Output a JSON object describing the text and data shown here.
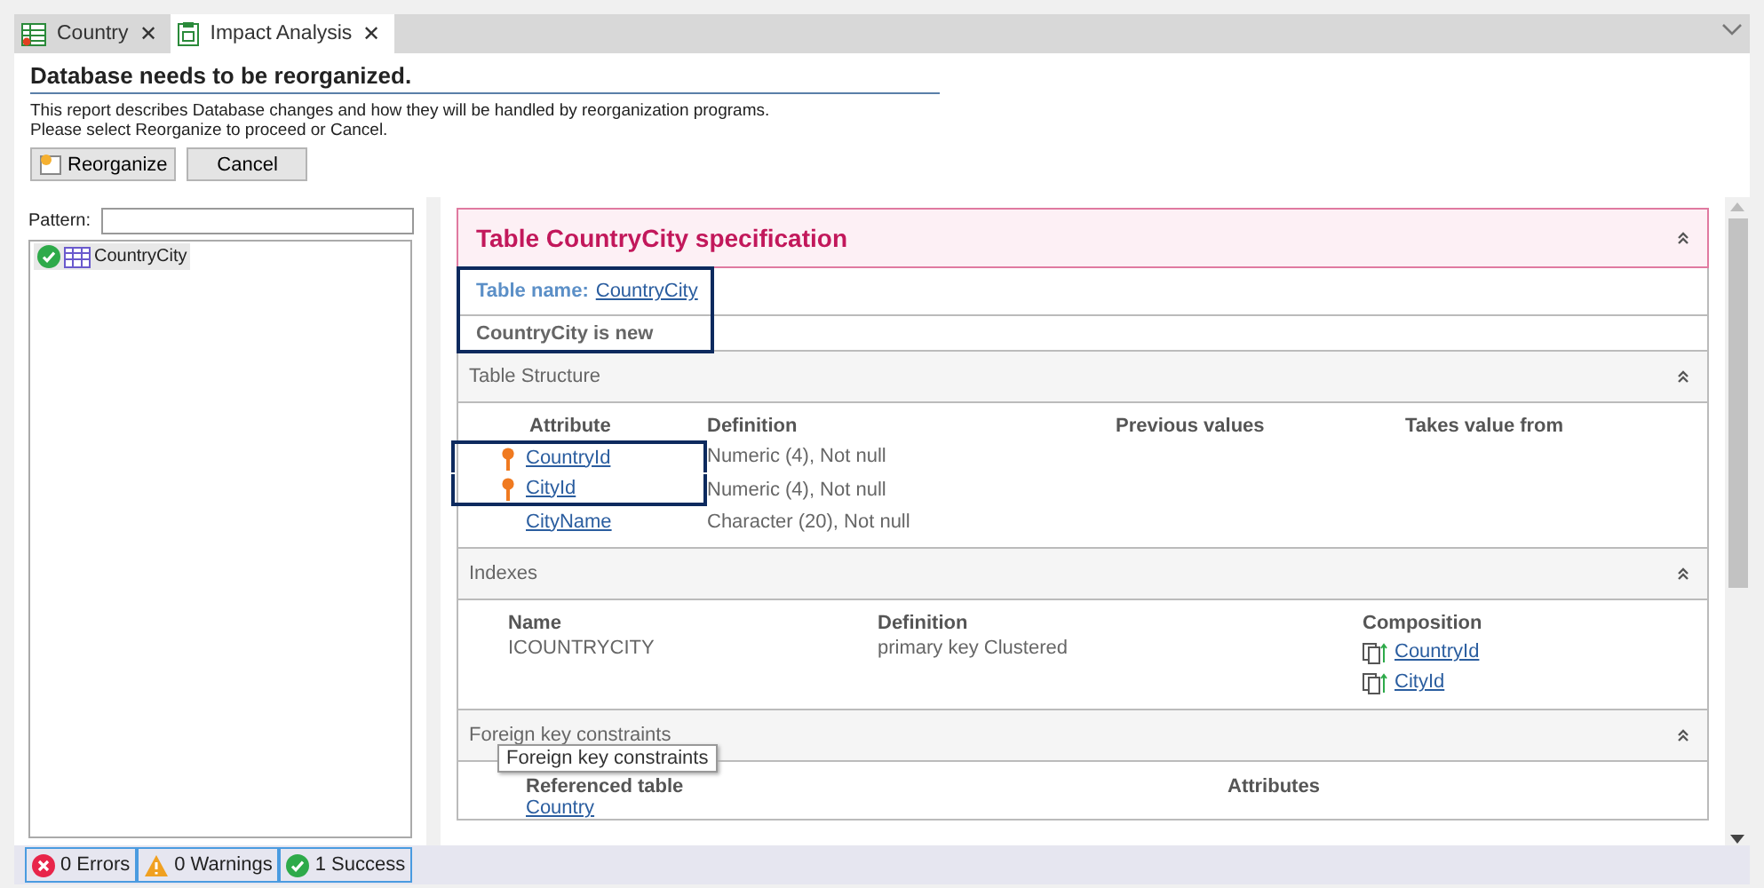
{
  "tabs": [
    {
      "label": "Country",
      "kind": "transaction",
      "selected": false,
      "close": "✕"
    },
    {
      "label": "Impact Analysis",
      "kind": "report",
      "selected": true,
      "close": "✕"
    }
  ],
  "header": {
    "title": "Database needs to be reorganized.",
    "description": [
      "This report describes Database changes and how they will be handled by reorganization programs.",
      "Please select Reorganize to proceed or Cancel."
    ],
    "buttons": [
      {
        "label": "Reorganize",
        "kind": "reorganize"
      },
      {
        "label": "Cancel",
        "kind": "plain"
      }
    ]
  },
  "filter": {
    "label": "Pattern:"
  },
  "tree": [
    {
      "label": "CountryCity",
      "kind": "success",
      "selected": true
    }
  ],
  "report": {
    "title": "Table CountryCity specification",
    "info": {
      "highlighted": true,
      "name_label": "Table name:",
      "name_link": "CountryCity",
      "status": "CountryCity is new"
    },
    "structure": {
      "title": "Table Structure",
      "columns": [
        "Attribute",
        "Definition",
        "Previous values",
        "Takes value from"
      ],
      "rows": [
        {
          "attribute": "CountryId",
          "key": true,
          "highlighted": true,
          "definition": "Numeric (4), Not null"
        },
        {
          "attribute": "CityId",
          "key": true,
          "highlighted": true,
          "definition": "Numeric (4), Not null"
        },
        {
          "attribute": "CityName",
          "key": false,
          "highlighted": false,
          "definition": "Character (20), Not null"
        }
      ]
    },
    "indexes": {
      "title": "Indexes",
      "columns": [
        "Name",
        "Definition",
        "Composition"
      ],
      "rows": [
        {
          "name": "ICOUNTRYCITY",
          "definition": "primary key Clustered",
          "composition": [
            "CountryId",
            "CityId"
          ]
        }
      ]
    },
    "foreign_keys": {
      "title": "Foreign key constraints",
      "tooltip": "Foreign key constraints",
      "columns": [
        "Referenced table",
        "Attributes"
      ],
      "rows": [
        {
          "table": "Country"
        }
      ]
    }
  },
  "status_bar": [
    {
      "label": "0 Errors",
      "kind": "error"
    },
    {
      "label": "0 Warnings",
      "kind": "warning"
    },
    {
      "label": "1 Success",
      "kind": "success"
    }
  ]
}
